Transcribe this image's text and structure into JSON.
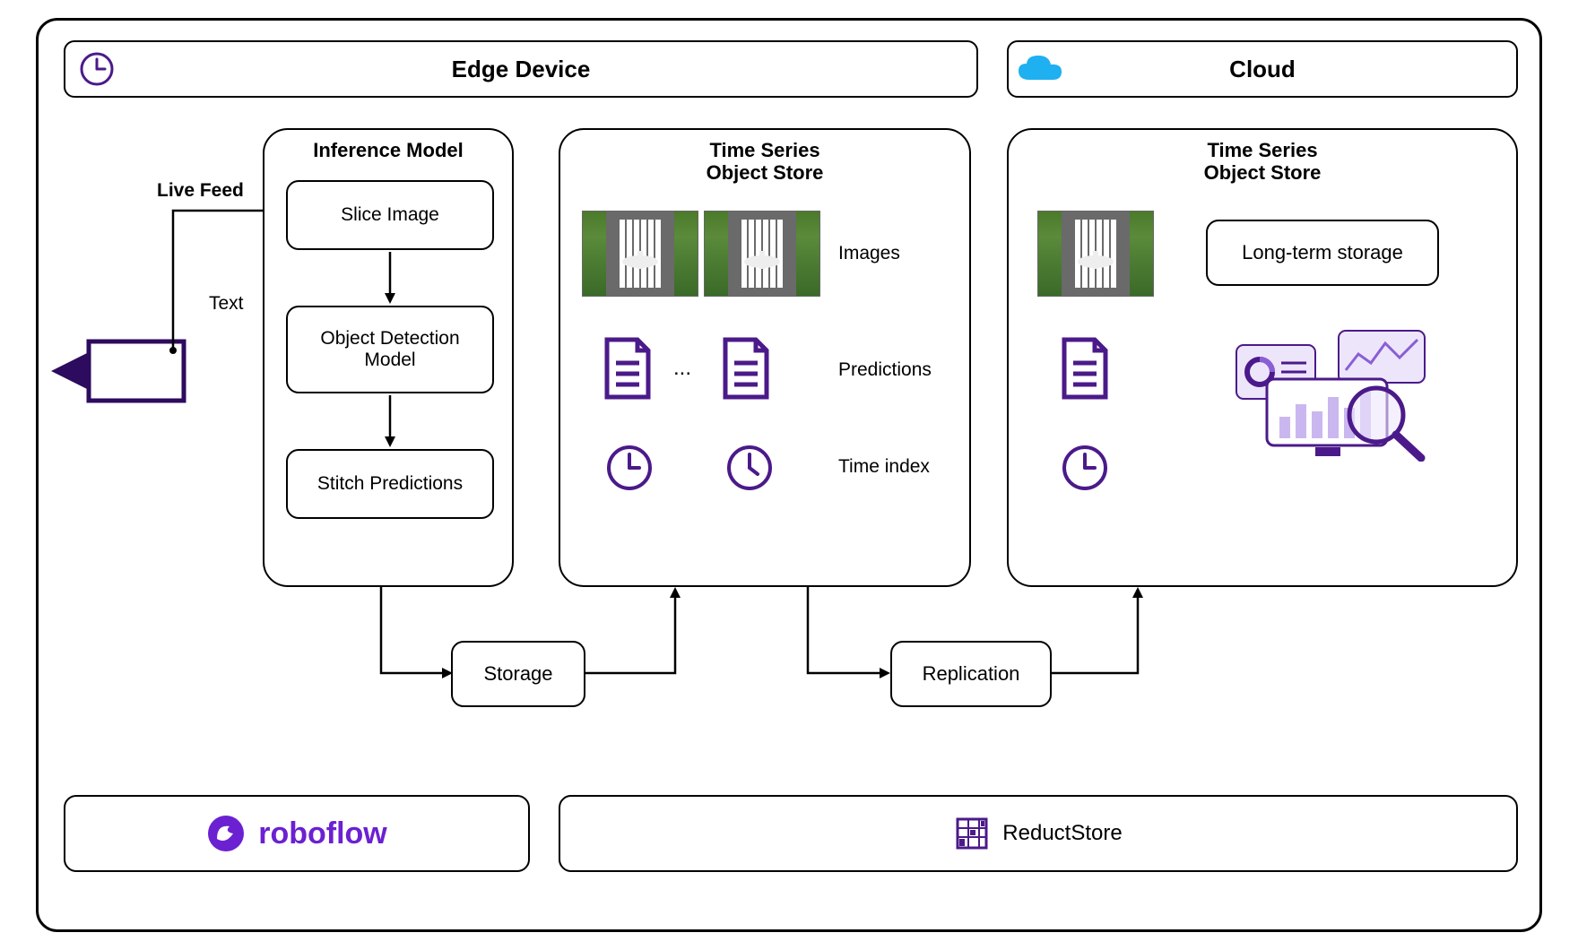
{
  "headers": {
    "edge": "Edge Device",
    "cloud": "Cloud"
  },
  "camera": {
    "live_feed_label": "Live Feed",
    "text_label": "Text"
  },
  "inference": {
    "title": "Inference Model",
    "steps": {
      "slice": "Slice Image",
      "detect": "Object Detection Model",
      "stitch": "Stitch Predictions"
    }
  },
  "tsos": {
    "title": "Time Series\nObject Store",
    "row_images": "Images",
    "row_predictions": "Predictions",
    "row_time": "Time index",
    "ellipsis": "..."
  },
  "cloud_box": {
    "longterm": "Long-term storage"
  },
  "connectors": {
    "storage": "Storage",
    "replication": "Replication"
  },
  "footer": {
    "roboflow": "roboflow",
    "reductstore": "ReductStore"
  },
  "colors": {
    "purple": "#4b1a8a",
    "purple_bright": "#6b21d1",
    "cloud_blue": "#1eb0f0"
  }
}
